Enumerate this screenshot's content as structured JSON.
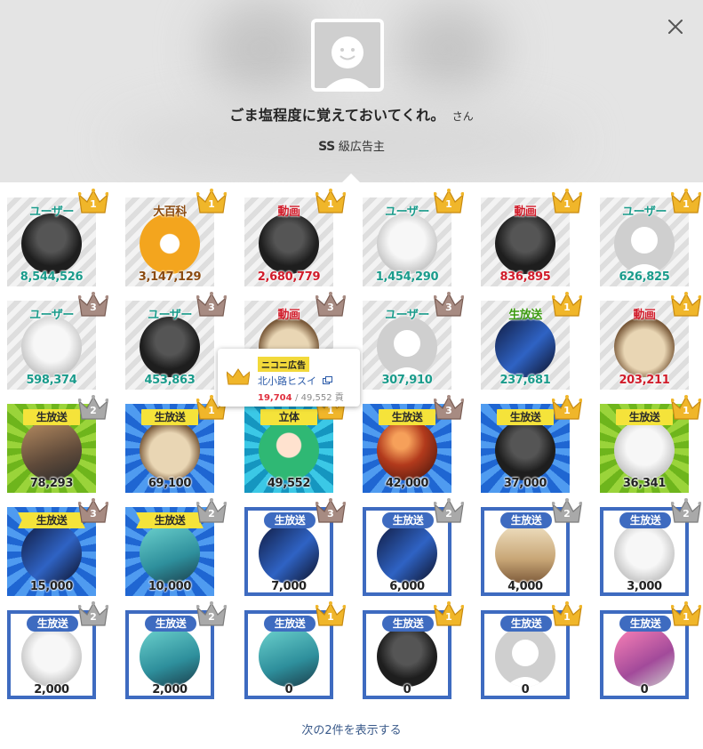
{
  "header": {
    "username": "ごま塩程度に覚えておいてくれ。",
    "honorific": "さん",
    "rank_grade": "SS",
    "rank_label": "級広告主"
  },
  "tooltip": {
    "badge": "ニコニ広告",
    "name": "北小路ヒスイ",
    "current": "19,704",
    "total": "/ 49,552 貢"
  },
  "footer": {
    "more_label": "次の2件を表示する"
  },
  "colors": {
    "gold": "#f0b62a",
    "silver": "#a9a9a9",
    "bronze": "#a78b82",
    "frame_blue": "#3e6bc0"
  },
  "cards": [
    {
      "label": "ユーザー",
      "value": "8,544,526",
      "crown": "1",
      "style": "user",
      "bg": "white",
      "img": "dark"
    },
    {
      "label": "大百科",
      "value": "3,147,129",
      "crown": "1",
      "style": "hyak",
      "bg": "white",
      "img": "orange"
    },
    {
      "label": "動画",
      "value": "2,680,779",
      "crown": "1",
      "style": "dyn",
      "bg": "white",
      "img": "dark"
    },
    {
      "label": "ユーザー",
      "value": "1,454,290",
      "crown": "1",
      "style": "user",
      "bg": "white",
      "img": "light"
    },
    {
      "label": "動画",
      "value": "836,895",
      "crown": "1",
      "style": "dyn",
      "bg": "white",
      "img": "dark"
    },
    {
      "label": "ユーザー",
      "value": "626,825",
      "crown": "1",
      "style": "user",
      "bg": "white",
      "img": "gray"
    },
    {
      "label": "ユーザー",
      "value": "598,374",
      "crown": "3",
      "style": "user",
      "bg": "white",
      "img": "light"
    },
    {
      "label": "ユーザー",
      "value": "453,863",
      "crown": "3",
      "style": "user",
      "bg": "white",
      "img": "dark"
    },
    {
      "label": "動画",
      "value": "",
      "crown": "3",
      "style": "dyn",
      "bg": "white",
      "img": "food"
    },
    {
      "label": "ユーザー",
      "value": "307,910",
      "crown": "3",
      "style": "user",
      "bg": "white",
      "img": "gray"
    },
    {
      "label": "生放送",
      "value": "237,681",
      "crown": "1",
      "style": "live",
      "bg": "white",
      "img": "blue"
    },
    {
      "label": "動画",
      "value": "203,211",
      "crown": "1",
      "style": "dyn",
      "bg": "white",
      "img": "food"
    },
    {
      "label": "生放送",
      "value": "78,293",
      "crown": "2",
      "style": "banner",
      "bg": "green",
      "img": "game"
    },
    {
      "label": "生放送",
      "value": "69,100",
      "crown": "1",
      "style": "banner",
      "bg": "blue",
      "img": "food"
    },
    {
      "label": "立体",
      "value": "49,552",
      "crown": "1",
      "style": "banner",
      "bg": "teal",
      "img": "green"
    },
    {
      "label": "生放送",
      "value": "42,000",
      "crown": "3",
      "style": "banner",
      "bg": "blue",
      "img": "red"
    },
    {
      "label": "生放送",
      "value": "37,000",
      "crown": "1",
      "style": "banner",
      "bg": "blue",
      "img": "dark"
    },
    {
      "label": "生放送",
      "value": "36,341",
      "crown": "1",
      "style": "banner",
      "bg": "green",
      "img": "light"
    },
    {
      "label": "生放送",
      "value": "15,000",
      "crown": "3",
      "style": "rib",
      "bg": "blue",
      "img": "blue"
    },
    {
      "label": "生放送",
      "value": "10,000",
      "crown": "2",
      "style": "rib",
      "bg": "blue",
      "img": "teal"
    },
    {
      "label": "生放送",
      "value": "7,000",
      "crown": "3",
      "style": "pill",
      "bg": "framed",
      "img": "blue"
    },
    {
      "label": "生放送",
      "value": "6,000",
      "crown": "2",
      "style": "pill",
      "bg": "framed",
      "img": "blue"
    },
    {
      "label": "生放送",
      "value": "4,000",
      "crown": "2",
      "style": "pill",
      "bg": "framed",
      "img": "tan"
    },
    {
      "label": "生放送",
      "value": "3,000",
      "crown": "2",
      "style": "pill",
      "bg": "framed",
      "img": "light"
    },
    {
      "label": "生放送",
      "value": "2,000",
      "crown": "2",
      "style": "pill",
      "bg": "framed",
      "img": "light"
    },
    {
      "label": "生放送",
      "value": "2,000",
      "crown": "2",
      "style": "pill",
      "bg": "framed",
      "img": "teal"
    },
    {
      "label": "生放送",
      "value": "0",
      "crown": "1",
      "style": "pill",
      "bg": "framed",
      "img": "teal"
    },
    {
      "label": "生放送",
      "value": "0",
      "crown": "1",
      "style": "pill",
      "bg": "framed",
      "img": "dark"
    },
    {
      "label": "生放送",
      "value": "0",
      "crown": "1",
      "style": "pill",
      "bg": "framed",
      "img": "gray"
    },
    {
      "label": "生放送",
      "value": "0",
      "crown": "1",
      "style": "pill",
      "bg": "framed",
      "img": "pink"
    }
  ]
}
